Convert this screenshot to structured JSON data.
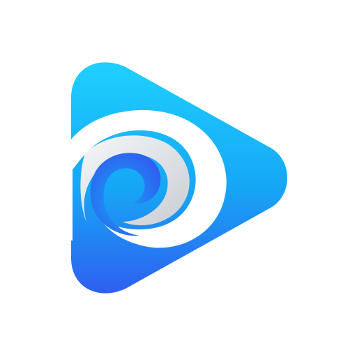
{
  "icon": {
    "name": "play-swirl-app-icon",
    "colors": {
      "background": "#ffffff",
      "gradient_top": "#1fd0ff",
      "gradient_mid": "#16a6f6",
      "gradient_bottom": "#2f5ff0",
      "swirl_white": "#ffffff",
      "swirl_gray_light": "#f5f7f9",
      "swirl_gray_dark": "#c9ced3"
    }
  }
}
